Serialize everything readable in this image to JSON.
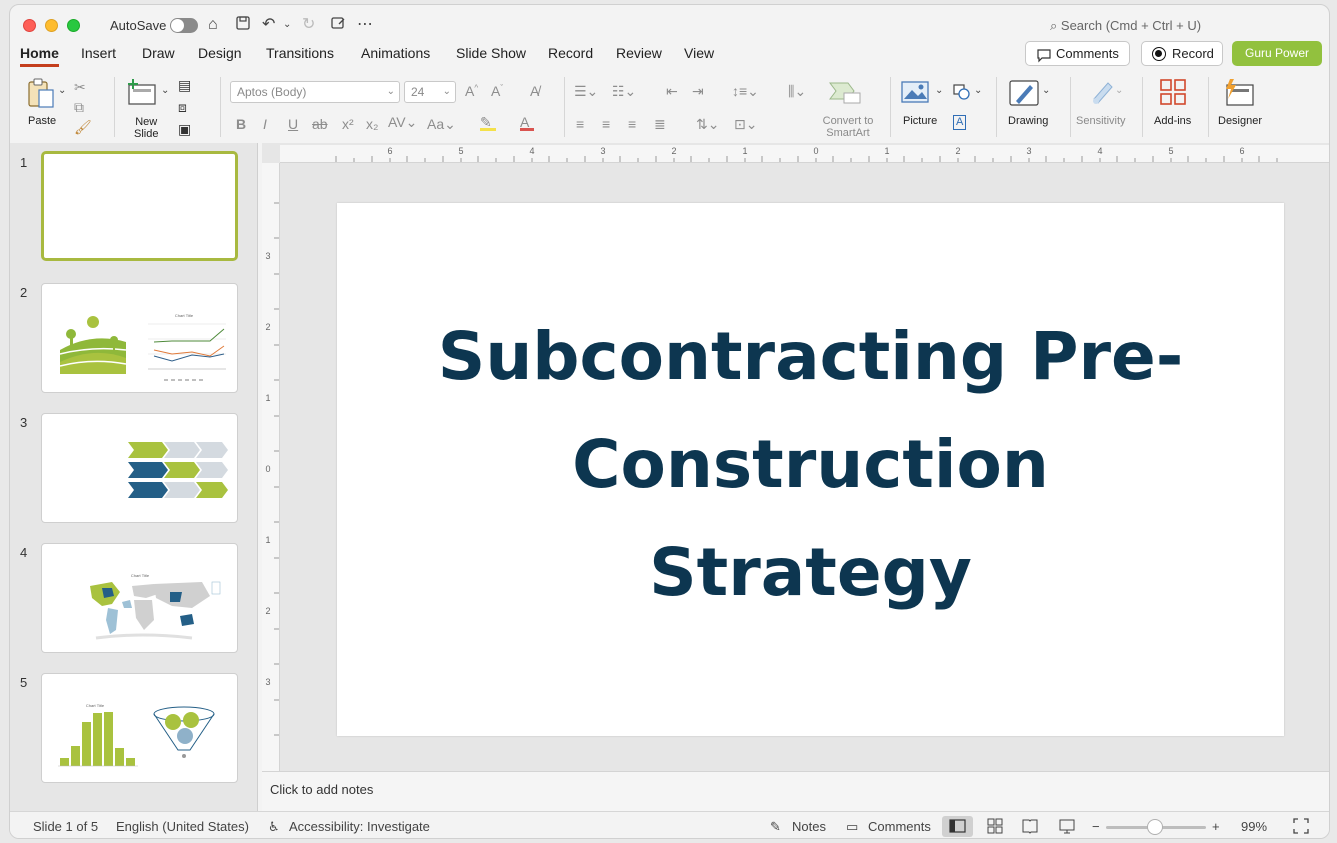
{
  "titlebar": {
    "autosave_label": "AutoSave",
    "search_placeholder": "Search (Cmd + Ctrl + U)"
  },
  "tabs": [
    "Home",
    "Insert",
    "Draw",
    "Design",
    "Transitions",
    "Animations",
    "Slide Show",
    "Record",
    "Review",
    "View"
  ],
  "actions": {
    "comments": "Comments",
    "record": "Record",
    "guru": "Guru Power"
  },
  "ribbon": {
    "paste": "Paste",
    "new_slide_1": "New",
    "new_slide_2": "Slide",
    "font_name": "Aptos (Body)",
    "font_size": "24",
    "convert_1": "Convert to",
    "convert_2": "SmartArt",
    "picture": "Picture",
    "drawing": "Drawing",
    "sensitivity": "Sensitivity",
    "addins": "Add-ins",
    "designer": "Designer"
  },
  "slides": [
    {
      "num": "1"
    },
    {
      "num": "2"
    },
    {
      "num": "3"
    },
    {
      "num": "4"
    },
    {
      "num": "5"
    }
  ],
  "thumbs": {
    "chart_title": "Chart Title"
  },
  "ruler": {
    "h": [
      "6",
      "5",
      "4",
      "3",
      "2",
      "1",
      "0",
      "1",
      "2",
      "3",
      "4",
      "5",
      "6"
    ],
    "v": [
      "3",
      "2",
      "1",
      "0",
      "1",
      "2",
      "3"
    ]
  },
  "slide": {
    "title_line1": "Subcontracting Pre-",
    "title_line2": "Construction",
    "title_line3": "Strategy"
  },
  "notes_placeholder": "Click to add notes",
  "status": {
    "slide_count": "Slide 1 of 5",
    "language": "English (United States)",
    "accessibility": "Accessibility: Investigate",
    "notes": "Notes",
    "comments": "Comments",
    "zoom_minus": "−",
    "zoom_plus": "+",
    "zoom": "99%"
  },
  "colors": {
    "accent_green": "#92c13e",
    "title_navy": "#0d3650",
    "tab_underline": "#c43e1c"
  }
}
